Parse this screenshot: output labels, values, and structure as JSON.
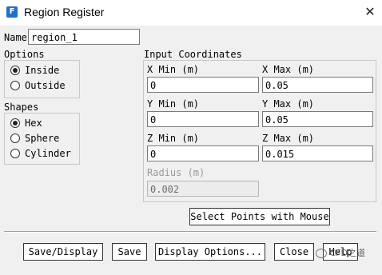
{
  "window": {
    "title": "Region Register",
    "app_icon_letter": "F"
  },
  "name": {
    "label": "Name",
    "value": "region_1"
  },
  "options": {
    "title": "Options",
    "items": [
      {
        "label": "Inside",
        "selected": true
      },
      {
        "label": "Outside",
        "selected": false
      }
    ]
  },
  "shapes": {
    "title": "Shapes",
    "items": [
      {
        "label": "Hex",
        "selected": true
      },
      {
        "label": "Sphere",
        "selected": false
      },
      {
        "label": "Cylinder",
        "selected": false
      }
    ]
  },
  "coords": {
    "title": "Input Coordinates",
    "x_min": {
      "label": "X Min (m)",
      "value": "0"
    },
    "x_max": {
      "label": "X Max (m)",
      "value": "0.05"
    },
    "y_min": {
      "label": "Y Min (m)",
      "value": "0"
    },
    "y_max": {
      "label": "Y Max (m)",
      "value": "0.05"
    },
    "z_min": {
      "label": "Z Min (m)",
      "value": "0"
    },
    "z_max": {
      "label": "Z Max (m)",
      "value": "0.015"
    },
    "radius": {
      "label": "Radius (m)",
      "value": "0.002",
      "enabled": false
    }
  },
  "select_points_label": "Select Points with Mouse",
  "buttons": {
    "save_display": "Save/Display",
    "save": "Save",
    "display_options": "Display Options...",
    "close": "Close",
    "help": "Help"
  },
  "watermark": "CFD之道"
}
